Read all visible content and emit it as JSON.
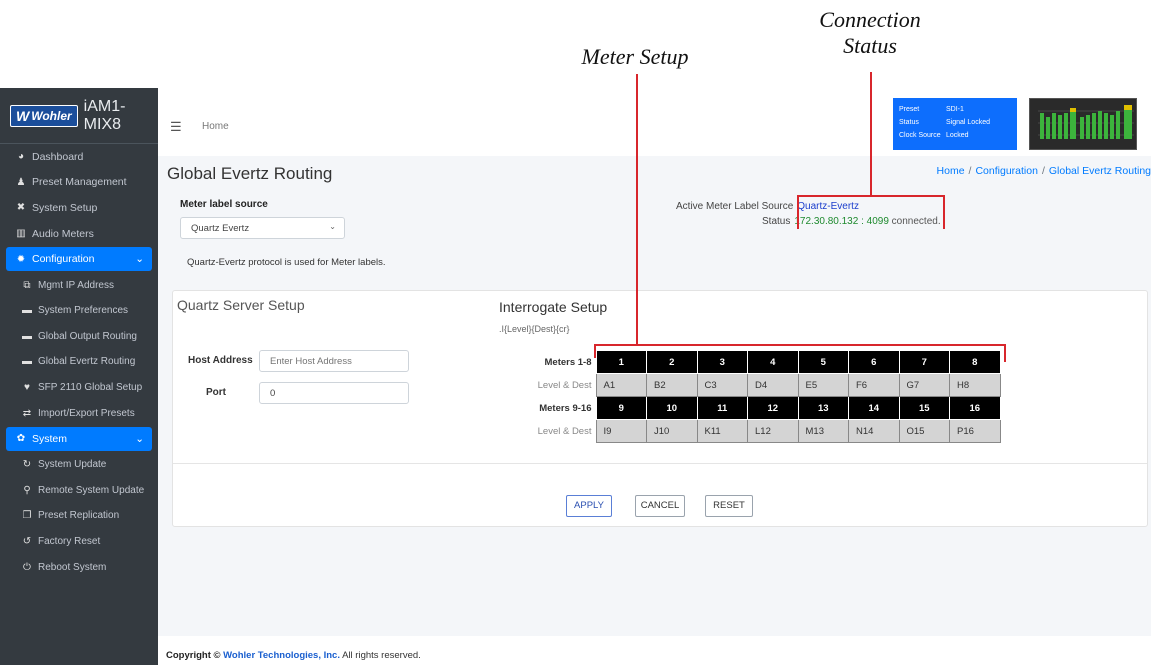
{
  "annotations": {
    "meter_setup": "Meter Setup",
    "connection_status_line1": "Connection",
    "connection_status_line2": "Status"
  },
  "app": {
    "logo": "Wohler",
    "title": "iAM1-MIX8"
  },
  "sidebar": {
    "items": [
      {
        "label": "Dashboard",
        "icon": "dashboard-icon"
      },
      {
        "label": "Preset Management",
        "icon": "users-icon"
      },
      {
        "label": "System Setup",
        "icon": "tools-icon"
      },
      {
        "label": "Audio Meters",
        "icon": "bar-chart-icon"
      },
      {
        "label": "Configuration",
        "icon": "gear-icon",
        "expanded": true
      },
      {
        "label": "Mgmt IP Address",
        "icon": "network-icon"
      },
      {
        "label": "System Preferences",
        "icon": "window-icon"
      },
      {
        "label": "Global Output Routing",
        "icon": "window-icon"
      },
      {
        "label": "Global Evertz Routing",
        "icon": "window-icon"
      },
      {
        "label": "SFP 2110 Global Setup",
        "icon": "shield-icon"
      },
      {
        "label": "Import/Export Presets",
        "icon": "exchange-icon"
      },
      {
        "label": "System",
        "icon": "gears-icon",
        "expanded": true
      },
      {
        "label": "System Update",
        "icon": "sync-icon"
      },
      {
        "label": "Remote System Update",
        "icon": "satellite-icon"
      },
      {
        "label": "Preset Replication",
        "icon": "copy-icon"
      },
      {
        "label": "Factory Reset",
        "icon": "undo-icon"
      },
      {
        "label": "Reboot System",
        "icon": "power-icon"
      }
    ]
  },
  "topbar": {
    "home": "Home",
    "status_box": {
      "preset_label": "Preset",
      "preset_value": "SDI-1",
      "status_label": "Status",
      "status_value": "Signal Locked",
      "clock_label": "Clock Source",
      "clock_value": "Locked",
      "bg_color": "#0d6efd"
    }
  },
  "page": {
    "title": "Global Evertz Routing",
    "breadcrumb": [
      "Home",
      "Configuration",
      "Global Evertz Routing"
    ],
    "meter_label_source_label": "Meter label source",
    "meter_label_source_value": "Quartz Evertz",
    "protocol_note": "Quartz-Evertz protocol is used for Meter labels.",
    "active_source_label": "Active Meter Label Source",
    "active_source_value": "Quartz-Evertz",
    "status_label": "Status",
    "status_value": "172.30.80.132 : 4099",
    "status_suffix": "connected."
  },
  "quartz": {
    "title": "Quartz Server Setup",
    "host_label": "Host Address",
    "host_placeholder": "Enter Host Address",
    "port_label": "Port",
    "port_value": "0"
  },
  "interrogate": {
    "title": "Interrogate Setup",
    "format": ".I{Level}{Dest}{cr}",
    "row1_label": "Meters 1-8",
    "row2_label": "Level & Dest",
    "row3_label": "Meters 9-16",
    "row4_label": "Level & Dest",
    "meters_1_8": [
      "1",
      "2",
      "3",
      "4",
      "5",
      "6",
      "7",
      "8"
    ],
    "dest_1_8": [
      "A1",
      "B2",
      "C3",
      "D4",
      "E5",
      "F6",
      "G7",
      "H8"
    ],
    "meters_9_16": [
      "9",
      "10",
      "11",
      "12",
      "13",
      "14",
      "15",
      "16"
    ],
    "dest_9_16": [
      "I9",
      "J10",
      "K11",
      "L12",
      "M13",
      "N14",
      "O15",
      "P16"
    ]
  },
  "buttons": {
    "apply": "APPLY",
    "cancel": "CANCEL",
    "reset": "RESET"
  },
  "footer": {
    "prefix": "Copyright ©",
    "company": "Wohler Technologies, Inc.",
    "suffix": "All rights reserved."
  },
  "colors": {
    "annotation_red": "#d8262c",
    "accent": "#007bff",
    "sidebar": "#343a40",
    "connected_green": "#1e8a2e"
  }
}
